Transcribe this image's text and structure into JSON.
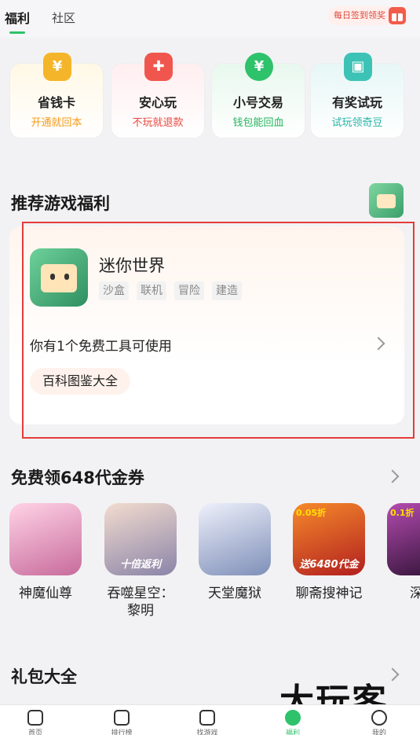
{
  "header": {
    "tabs": [
      {
        "label": "福利",
        "active": true
      },
      {
        "label": "社区",
        "active": false
      }
    ],
    "checkin_label": "每日签到领奖"
  },
  "features": [
    {
      "title": "省钱卡",
      "subtitle": "开通就回本",
      "icon": "wallet-icon",
      "subtitle_color": "#f59a1b"
    },
    {
      "title": "安心玩",
      "subtitle": "不玩就退款",
      "icon": "gamepad-shield-icon",
      "subtitle_color": "#e8483f"
    },
    {
      "title": "小号交易",
      "subtitle": "钱包能回血",
      "icon": "yen-coin-icon",
      "subtitle_color": "#25b45f"
    },
    {
      "title": "有奖试玩",
      "subtitle": "试玩领奇豆",
      "icon": "gift-box-icon",
      "subtitle_color": "#27b3a6"
    }
  ],
  "recommend": {
    "section_title": "推荐游戏福利",
    "game_name": "迷你世界",
    "tags": [
      "沙盒",
      "联机",
      "冒险",
      "建造"
    ],
    "tool_text": "你有1个免费工具可使用",
    "tool_button": "百科图鉴大全"
  },
  "vouchers": {
    "section_title": "免费领648代金券",
    "games": [
      {
        "name": "神魔仙尊",
        "name2": "",
        "colors": [
          "#c86b9c",
          "#ffd3e6"
        ],
        "banner": "",
        "badge": ""
      },
      {
        "name": "吞噬星空：",
        "name2": "黎明",
        "colors": [
          "#8a84a8",
          "#f3dccf"
        ],
        "banner": "十倍返利",
        "badge": ""
      },
      {
        "name": "天堂魔狱",
        "name2": "",
        "colors": [
          "#7e8fb8",
          "#eef0fb"
        ],
        "banner": "",
        "badge": ""
      },
      {
        "name": "聊斋搜神记",
        "name2": "",
        "colors": [
          "#b21f1f",
          "#f58a2b"
        ],
        "banner": "送6480代金",
        "badge": "0.05折"
      },
      {
        "name": "深渊",
        "name2": "",
        "colors": [
          "#b44bb0",
          "#2a1030"
        ],
        "banner": "",
        "badge": "0.1折"
      }
    ]
  },
  "gifts": {
    "section_title": "礼包大全"
  },
  "watermark": "大玩客",
  "bottom_nav": [
    {
      "label": "首页",
      "icon": "home-icon",
      "active": false
    },
    {
      "label": "排行榜",
      "icon": "phone-icon",
      "active": false
    },
    {
      "label": "找游戏",
      "icon": "gamepad-icon",
      "active": false
    },
    {
      "label": "福利",
      "icon": "leaf-icon",
      "active": true
    },
    {
      "label": "我的",
      "icon": "face-icon",
      "active": false
    }
  ],
  "colors": {
    "accent": "#2ec26b",
    "highlight_frame": "#e53b3b"
  }
}
